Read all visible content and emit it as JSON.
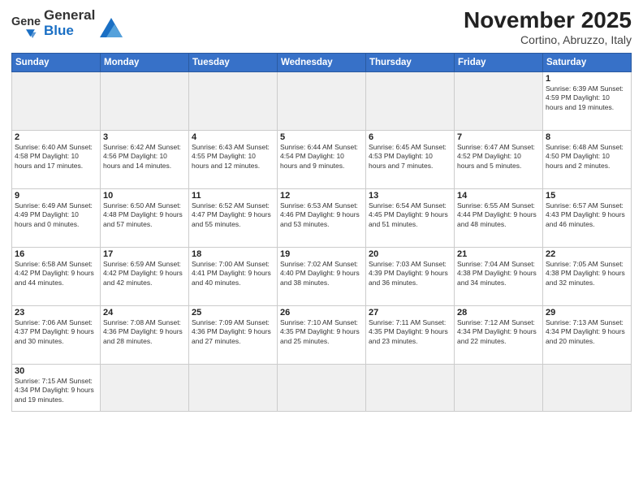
{
  "logo": {
    "general": "General",
    "blue": "Blue"
  },
  "title": "November 2025",
  "subtitle": "Cortino, Abruzzo, Italy",
  "weekdays": [
    "Sunday",
    "Monday",
    "Tuesday",
    "Wednesday",
    "Thursday",
    "Friday",
    "Saturday"
  ],
  "weeks": [
    [
      {
        "day": "",
        "info": ""
      },
      {
        "day": "",
        "info": ""
      },
      {
        "day": "",
        "info": ""
      },
      {
        "day": "",
        "info": ""
      },
      {
        "day": "",
        "info": ""
      },
      {
        "day": "",
        "info": ""
      },
      {
        "day": "1",
        "info": "Sunrise: 6:39 AM\nSunset: 4:59 PM\nDaylight: 10 hours\nand 19 minutes."
      }
    ],
    [
      {
        "day": "2",
        "info": "Sunrise: 6:40 AM\nSunset: 4:58 PM\nDaylight: 10 hours\nand 17 minutes."
      },
      {
        "day": "3",
        "info": "Sunrise: 6:42 AM\nSunset: 4:56 PM\nDaylight: 10 hours\nand 14 minutes."
      },
      {
        "day": "4",
        "info": "Sunrise: 6:43 AM\nSunset: 4:55 PM\nDaylight: 10 hours\nand 12 minutes."
      },
      {
        "day": "5",
        "info": "Sunrise: 6:44 AM\nSunset: 4:54 PM\nDaylight: 10 hours\nand 9 minutes."
      },
      {
        "day": "6",
        "info": "Sunrise: 6:45 AM\nSunset: 4:53 PM\nDaylight: 10 hours\nand 7 minutes."
      },
      {
        "day": "7",
        "info": "Sunrise: 6:47 AM\nSunset: 4:52 PM\nDaylight: 10 hours\nand 5 minutes."
      },
      {
        "day": "8",
        "info": "Sunrise: 6:48 AM\nSunset: 4:50 PM\nDaylight: 10 hours\nand 2 minutes."
      }
    ],
    [
      {
        "day": "9",
        "info": "Sunrise: 6:49 AM\nSunset: 4:49 PM\nDaylight: 10 hours\nand 0 minutes."
      },
      {
        "day": "10",
        "info": "Sunrise: 6:50 AM\nSunset: 4:48 PM\nDaylight: 9 hours\nand 57 minutes."
      },
      {
        "day": "11",
        "info": "Sunrise: 6:52 AM\nSunset: 4:47 PM\nDaylight: 9 hours\nand 55 minutes."
      },
      {
        "day": "12",
        "info": "Sunrise: 6:53 AM\nSunset: 4:46 PM\nDaylight: 9 hours\nand 53 minutes."
      },
      {
        "day": "13",
        "info": "Sunrise: 6:54 AM\nSunset: 4:45 PM\nDaylight: 9 hours\nand 51 minutes."
      },
      {
        "day": "14",
        "info": "Sunrise: 6:55 AM\nSunset: 4:44 PM\nDaylight: 9 hours\nand 48 minutes."
      },
      {
        "day": "15",
        "info": "Sunrise: 6:57 AM\nSunset: 4:43 PM\nDaylight: 9 hours\nand 46 minutes."
      }
    ],
    [
      {
        "day": "16",
        "info": "Sunrise: 6:58 AM\nSunset: 4:42 PM\nDaylight: 9 hours\nand 44 minutes."
      },
      {
        "day": "17",
        "info": "Sunrise: 6:59 AM\nSunset: 4:42 PM\nDaylight: 9 hours\nand 42 minutes."
      },
      {
        "day": "18",
        "info": "Sunrise: 7:00 AM\nSunset: 4:41 PM\nDaylight: 9 hours\nand 40 minutes."
      },
      {
        "day": "19",
        "info": "Sunrise: 7:02 AM\nSunset: 4:40 PM\nDaylight: 9 hours\nand 38 minutes."
      },
      {
        "day": "20",
        "info": "Sunrise: 7:03 AM\nSunset: 4:39 PM\nDaylight: 9 hours\nand 36 minutes."
      },
      {
        "day": "21",
        "info": "Sunrise: 7:04 AM\nSunset: 4:38 PM\nDaylight: 9 hours\nand 34 minutes."
      },
      {
        "day": "22",
        "info": "Sunrise: 7:05 AM\nSunset: 4:38 PM\nDaylight: 9 hours\nand 32 minutes."
      }
    ],
    [
      {
        "day": "23",
        "info": "Sunrise: 7:06 AM\nSunset: 4:37 PM\nDaylight: 9 hours\nand 30 minutes."
      },
      {
        "day": "24",
        "info": "Sunrise: 7:08 AM\nSunset: 4:36 PM\nDaylight: 9 hours\nand 28 minutes."
      },
      {
        "day": "25",
        "info": "Sunrise: 7:09 AM\nSunset: 4:36 PM\nDaylight: 9 hours\nand 27 minutes."
      },
      {
        "day": "26",
        "info": "Sunrise: 7:10 AM\nSunset: 4:35 PM\nDaylight: 9 hours\nand 25 minutes."
      },
      {
        "day": "27",
        "info": "Sunrise: 7:11 AM\nSunset: 4:35 PM\nDaylight: 9 hours\nand 23 minutes."
      },
      {
        "day": "28",
        "info": "Sunrise: 7:12 AM\nSunset: 4:34 PM\nDaylight: 9 hours\nand 22 minutes."
      },
      {
        "day": "29",
        "info": "Sunrise: 7:13 AM\nSunset: 4:34 PM\nDaylight: 9 hours\nand 20 minutes."
      }
    ],
    [
      {
        "day": "30",
        "info": "Sunrise: 7:15 AM\nSunset: 4:34 PM\nDaylight: 9 hours\nand 19 minutes."
      },
      {
        "day": "",
        "info": ""
      },
      {
        "day": "",
        "info": ""
      },
      {
        "day": "",
        "info": ""
      },
      {
        "day": "",
        "info": ""
      },
      {
        "day": "",
        "info": ""
      },
      {
        "day": "",
        "info": ""
      }
    ]
  ]
}
